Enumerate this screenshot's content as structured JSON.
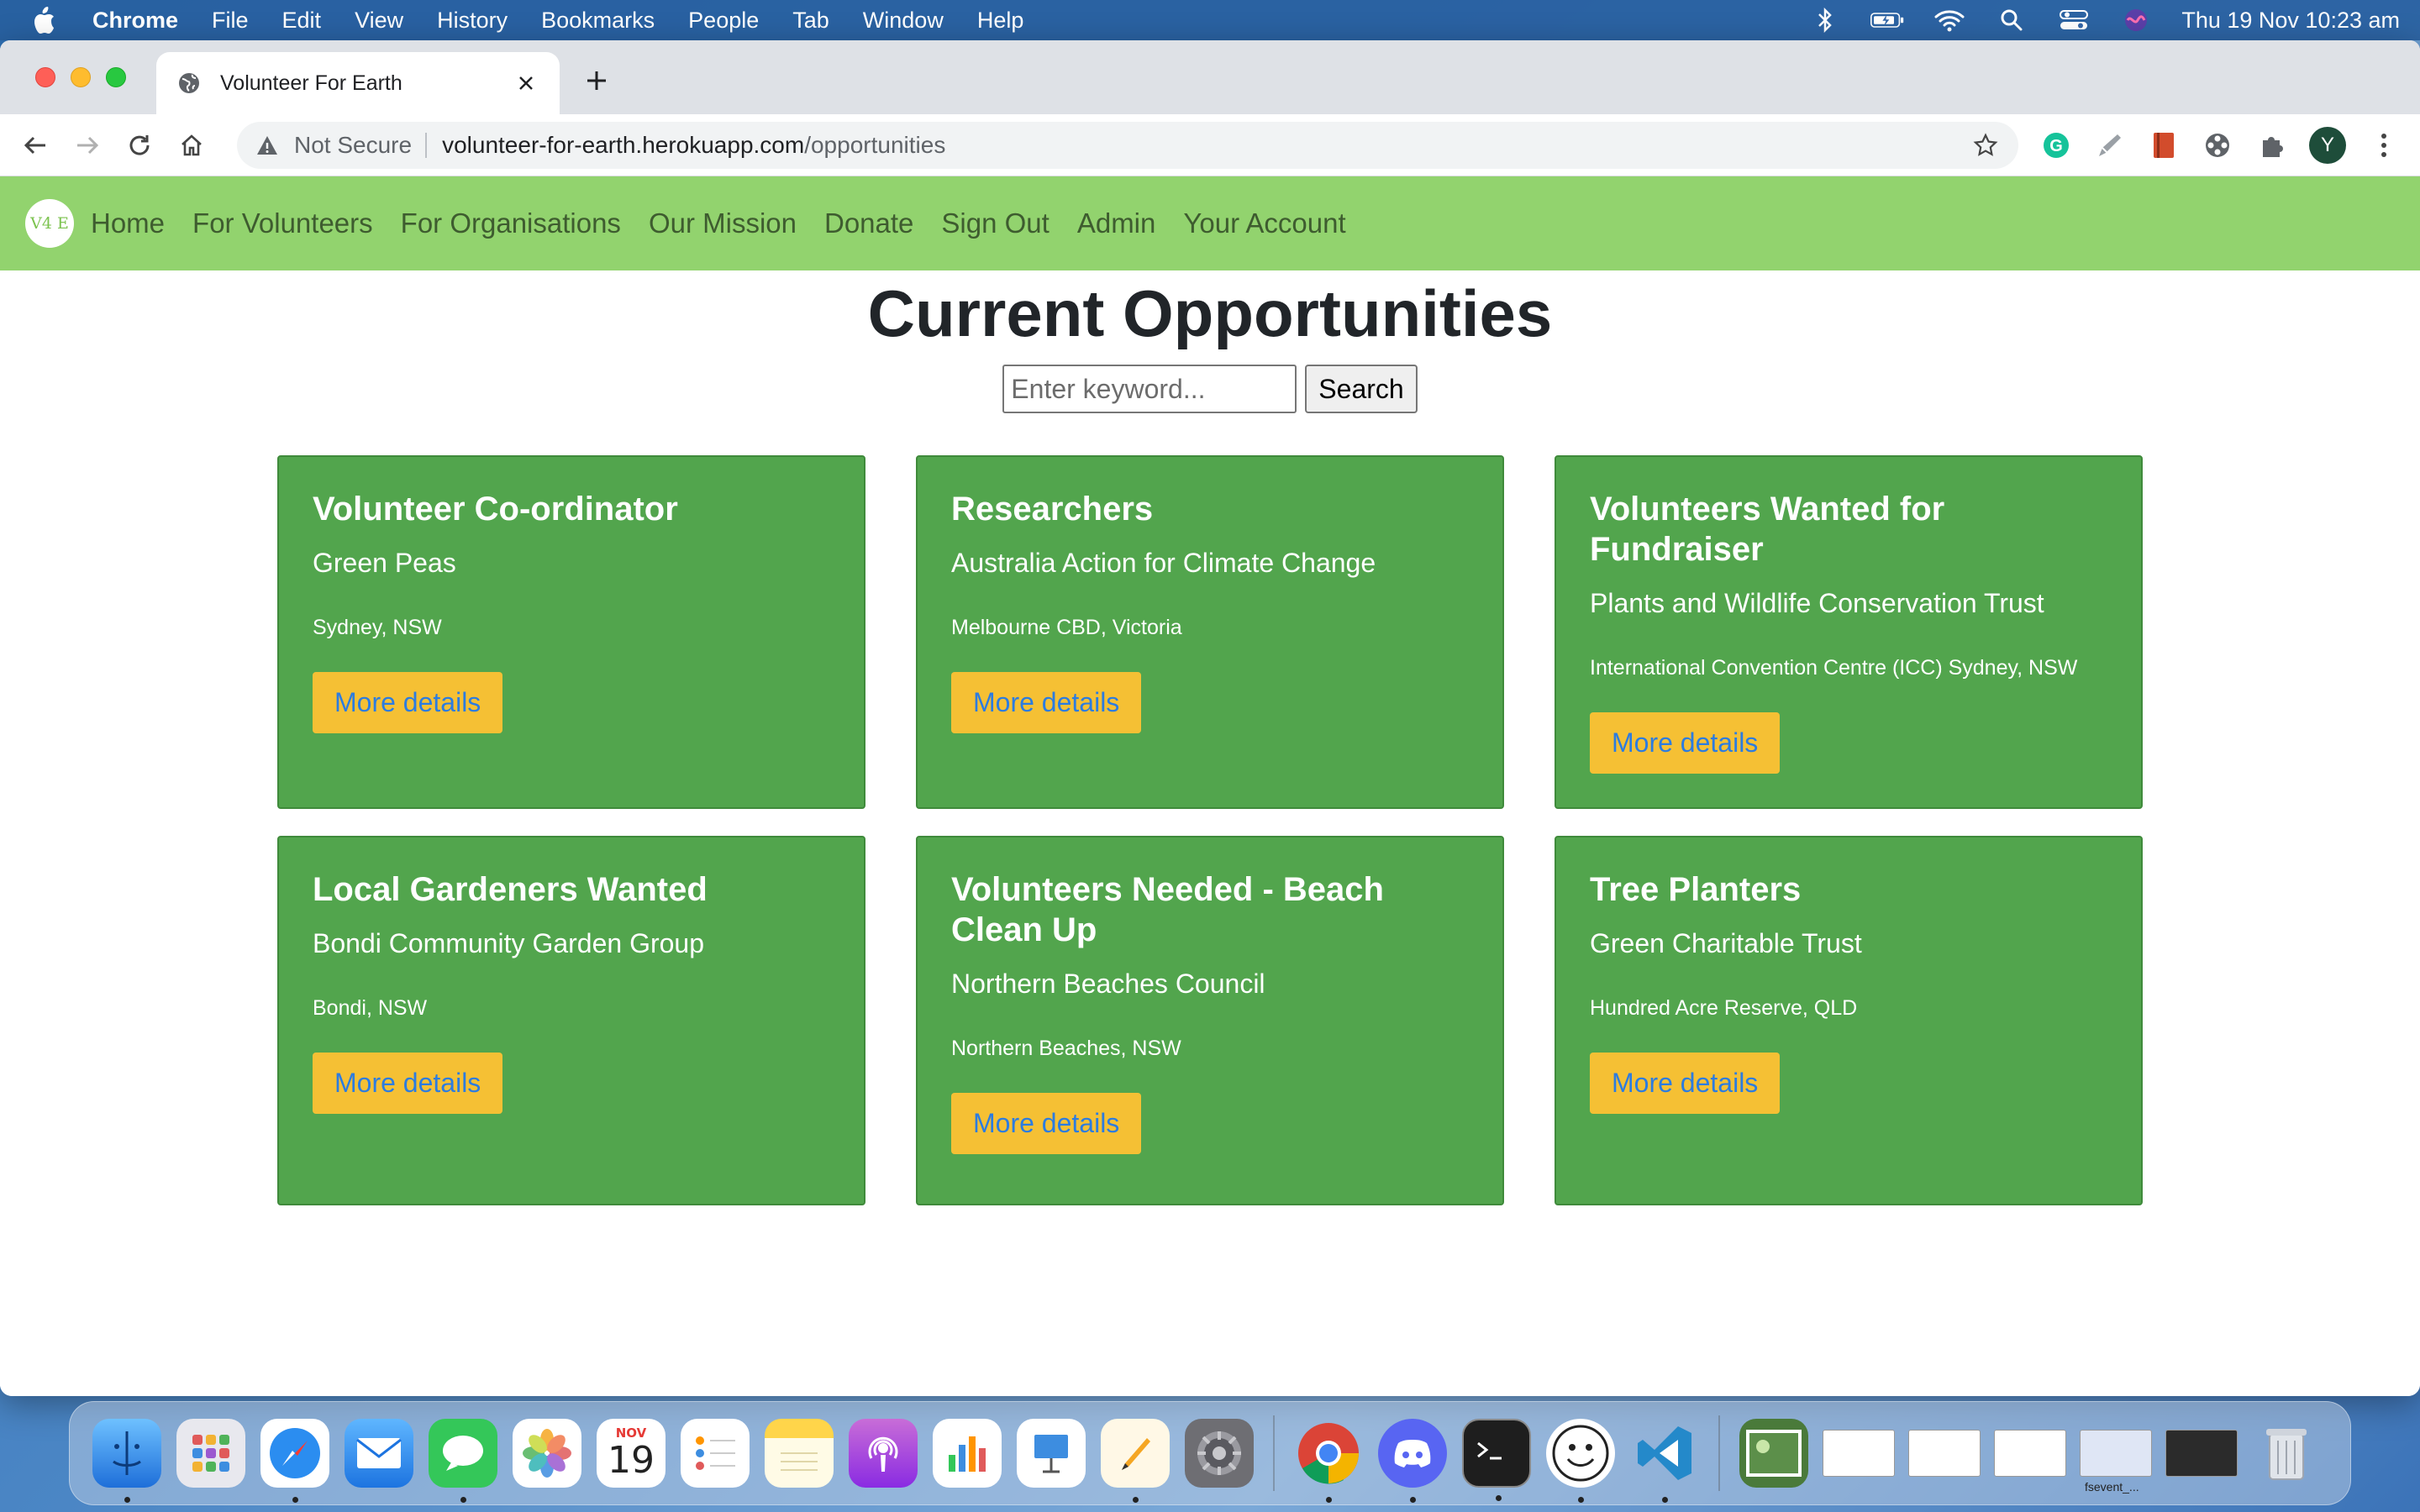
{
  "menubar": {
    "app": "Chrome",
    "items": [
      "File",
      "Edit",
      "View",
      "History",
      "Bookmarks",
      "People",
      "Tab",
      "Window",
      "Help"
    ],
    "datetime": "Thu 19 Nov  10:23 am"
  },
  "browser": {
    "tab_title": "Volunteer For Earth",
    "security_label": "Not Secure",
    "url_host": "volunteer-for-earth.herokuapp.com",
    "url_path": "/opportunities",
    "profile_initial": "Y"
  },
  "site": {
    "logo_text": "V4 E",
    "nav": [
      "Home",
      "For Volunteers",
      "For Organisations",
      "Our Mission",
      "Donate",
      "Sign Out",
      "Admin",
      "Your Account"
    ]
  },
  "page": {
    "title": "Current Opportunities",
    "search_placeholder": "Enter keyword...",
    "search_button": "Search",
    "cards": [
      {
        "title": "Volunteer Co-ordinator",
        "org": "Green Peas",
        "location": "Sydney, NSW",
        "button": "More details"
      },
      {
        "title": "Researchers",
        "org": "Australia Action for Climate Change",
        "location": "Melbourne CBD, Victoria",
        "button": "More details"
      },
      {
        "title": "Volunteers Wanted for Fundraiser",
        "org": "Plants and Wildlife Conservation Trust",
        "location": "International Convention Centre (ICC) Sydney, NSW",
        "button": "More details"
      },
      {
        "title": "Local Gardeners Wanted",
        "org": "Bondi Community Garden Group",
        "location": "Bondi, NSW",
        "button": "More details"
      },
      {
        "title": "Volunteers Needed - Beach Clean Up",
        "org": "Northern Beaches Council",
        "location": "Northern Beaches, NSW",
        "button": "More details"
      },
      {
        "title": "Tree Planters",
        "org": "Green Charitable Trust",
        "location": "Hundred Acre Reserve, QLD",
        "button": "More details"
      }
    ]
  },
  "dock": {
    "calendar_month": "NOV",
    "calendar_day": "19",
    "thumb_label": "fsevent_..."
  },
  "colors": {
    "nav_bg": "#92d36e",
    "card_bg": "#52a54d",
    "button_bg": "#f5c034",
    "button_text": "#2c7ce0"
  }
}
